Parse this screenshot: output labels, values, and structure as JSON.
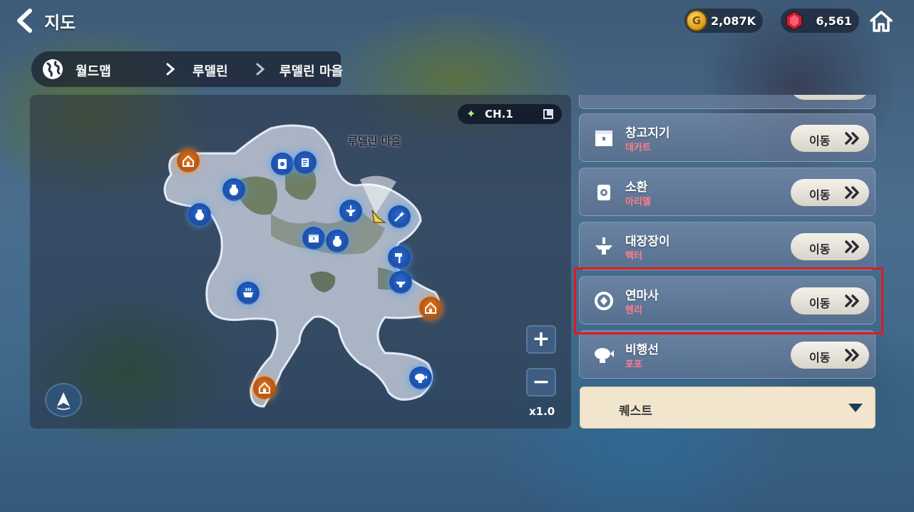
{
  "header": {
    "title": "지도",
    "gold": "2,087K",
    "gems": "6,561"
  },
  "breadcrumb": [
    "월드맵",
    "루델린",
    "루델린 마을"
  ],
  "map": {
    "chapter": "CH.1",
    "area_name": "루델린 마을",
    "zoom": "x1.0",
    "zoom_in_label": "+",
    "zoom_out_label": "−"
  },
  "npc_list": [
    {
      "role": "창고지기",
      "npc": "데카트",
      "button": "이동",
      "icon": "storage-box-icon"
    },
    {
      "role": "소환",
      "npc": "아리엘",
      "button": "이동",
      "icon": "summon-scroll-icon"
    },
    {
      "role": "대장장이",
      "npc": "헥터",
      "button": "이동",
      "icon": "anvil-icon"
    },
    {
      "role": "연마사",
      "npc": "헨리",
      "button": "이동",
      "icon": "gear-gem-icon"
    },
    {
      "role": "비행선",
      "npc": "포포",
      "button": "이동",
      "icon": "airship-icon"
    }
  ],
  "quest": {
    "label": "퀘스트"
  },
  "colors": {
    "highlight": "#e0191f",
    "npc_name": "#ff7d8a",
    "poi_blue": "#2a6bd6",
    "poi_orange": "#e07a26",
    "quest_bg": "#f1e6cd"
  }
}
